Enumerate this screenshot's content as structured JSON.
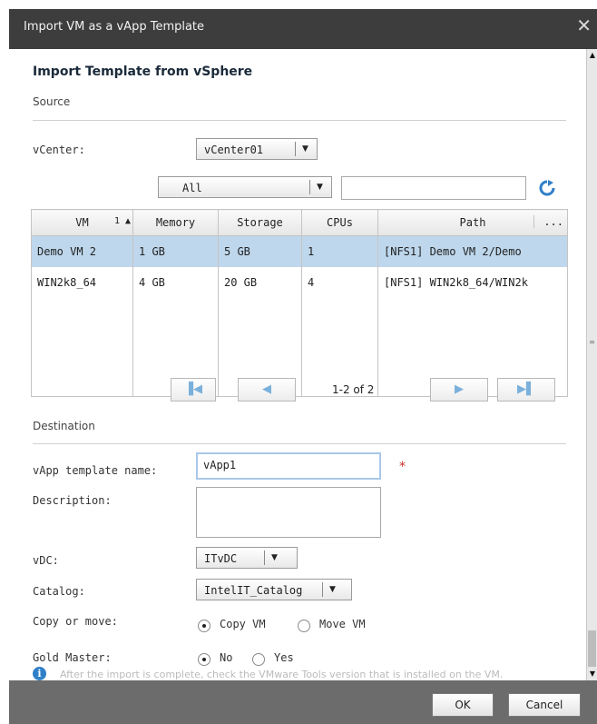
{
  "dialog": {
    "title": "Import VM as a vApp Template",
    "close_glyph": "✕"
  },
  "form": {
    "heading": "Import Template from vSphere",
    "source_section": "Source",
    "vcenter_label": "vCenter:",
    "vcenter_value": "vCenter01",
    "filter_value": "All",
    "search_value": "",
    "refresh_icon": "refresh-icon"
  },
  "table": {
    "columns": [
      "VM",
      "Memory",
      "Storage",
      "CPUs",
      "Path"
    ],
    "sort_indicator": "1 ▲",
    "more_glyph": "...",
    "rows": [
      [
        "Demo VM 2",
        "1 GB",
        "5 GB",
        "1",
        "[NFS1] Demo VM 2/Demo"
      ],
      [
        "WIN2k8_64",
        "4 GB",
        "20 GB",
        "4",
        "[NFS1] WIN2k8_64/WIN2k"
      ]
    ],
    "selected_row": 0
  },
  "pagination": {
    "status": "1-2 of 2",
    "first_glyph": "▐◀",
    "prev_glyph": "◀",
    "next_glyph": "▶",
    "last_glyph": "▶▌"
  },
  "destination": {
    "section": "Destination",
    "name_label": "vApp template name:",
    "name_value": "vApp1",
    "required_mark": "*",
    "description_label": "Description:",
    "description_value": "",
    "vdc_label": "vDC:",
    "vdc_value": "ITvDC",
    "catalog_label": "Catalog:",
    "catalog_value": "IntelIT_Catalog",
    "copy_move_label": "Copy or move:",
    "copy_option": "Copy VM",
    "move_option": "Move VM",
    "copy_selected": true,
    "gold_label": "Gold Master:",
    "gold_no": "No",
    "gold_yes": "Yes",
    "gold_selected": "No"
  },
  "info": {
    "text": "After the import is complete, check the VMware Tools version that is installed on the VM."
  },
  "footer": {
    "ok_label": "OK",
    "cancel_label": "Cancel"
  },
  "colors": {
    "accent": "#2f7fc8",
    "selection": "#bed7ec",
    "required": "#cc2b2b",
    "titlebar": "#3d3d3d"
  }
}
